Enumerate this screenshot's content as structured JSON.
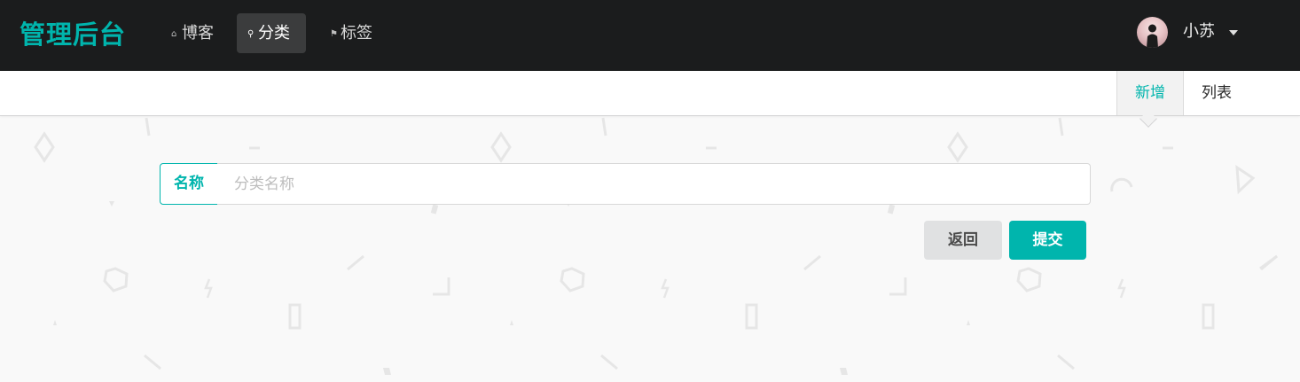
{
  "brand": {
    "title": "管理后台",
    "color": "#00b5ad"
  },
  "nav": {
    "items": [
      {
        "label": "博客",
        "icon": "home-icon",
        "active": false
      },
      {
        "label": "分类",
        "icon": "lightbulb-icon",
        "active": true
      },
      {
        "label": "标签",
        "icon": "tags-icon",
        "active": false
      }
    ]
  },
  "user": {
    "name": "小苏",
    "avatar": "user-avatar",
    "menu_icon": "caret-down-icon"
  },
  "subnav": {
    "tabs": [
      {
        "label": "新增",
        "active": true
      },
      {
        "label": "列表",
        "active": false
      }
    ]
  },
  "form": {
    "name_label": "名称",
    "name_value": "",
    "name_placeholder": "分类名称",
    "back_label": "返回",
    "submit_label": "提交"
  },
  "colors": {
    "accent": "#00b5ad",
    "topbar": "#1b1c1d",
    "page_background": "#f9f9f9"
  }
}
